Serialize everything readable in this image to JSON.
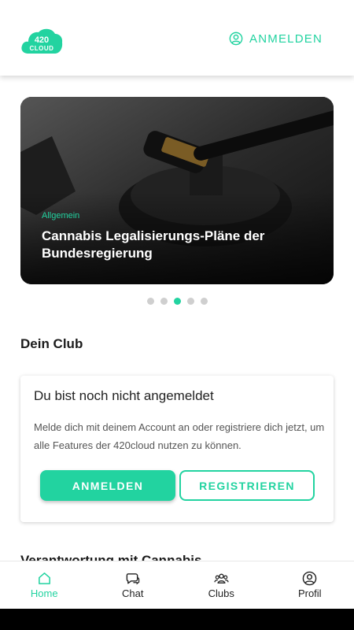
{
  "header": {
    "logo_text": "420 CLOUD",
    "login_label": "ANMELDEN"
  },
  "carousel": {
    "category": "Allgemein",
    "title": "Cannabis Legalisierungs-Pläne der Bundesregierung",
    "slide_count": 5,
    "active_index": 2
  },
  "club": {
    "section_title": "Dein Club",
    "card_title": "Du bist noch nicht angemeldet",
    "card_text": "Melde dich mit deinem Account an oder registriere dich jetzt, um alle Features der 420cloud nutzen zu können.",
    "login_button": "ANMELDEN",
    "register_button": "REGISTRIEREN"
  },
  "next_section_title": "Verantwortung mit Cannabis",
  "tabs": [
    {
      "label": "Home",
      "icon": "home-icon",
      "active": true
    },
    {
      "label": "Chat",
      "icon": "chat-icon",
      "active": false
    },
    {
      "label": "Clubs",
      "icon": "group-icon",
      "active": false
    },
    {
      "label": "Profil",
      "icon": "profile-icon",
      "active": false
    }
  ],
  "colors": {
    "accent": "#22d3a0",
    "text": "#1b1b1b",
    "muted": "#555555"
  }
}
